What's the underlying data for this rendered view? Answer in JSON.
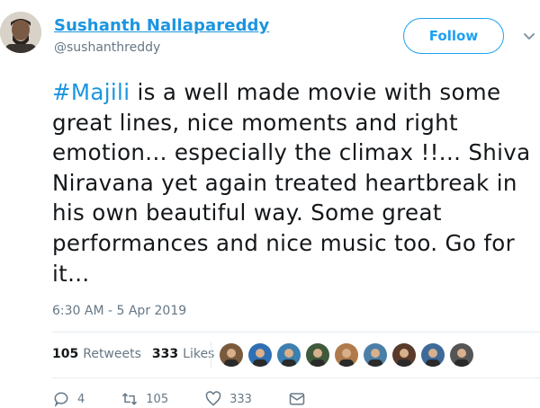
{
  "tweet": {
    "author_name": "Sushanth Nallapareddy",
    "handle": "@sushanthreddy",
    "follow_label": "Follow",
    "hashtag": "#Majili",
    "text_rest": " is a well made movie with some great lines, nice moments and right emotion... especially the climax !!... Shiva Niravana yet again treated heartbreak in his own beautiful way. Some great performances and nice music too. Go for it...",
    "timestamp": "6:30 AM - 5 Apr 2019"
  },
  "stats": {
    "retweets_count": "105",
    "retweets_label": "Retweets",
    "likes_count": "333",
    "likes_label": "Likes"
  },
  "liked_by_avatars": [
    {
      "color": "#7a5a3c"
    },
    {
      "color": "#2f6fb3"
    },
    {
      "color": "#3c7fb0"
    },
    {
      "color": "#3f5a3a"
    },
    {
      "color": "#b07a4a"
    },
    {
      "color": "#4a7fa8"
    },
    {
      "color": "#5a3a2a"
    },
    {
      "color": "#3e6a9a"
    },
    {
      "color": "#555555"
    }
  ],
  "actions": {
    "reply_count": "4",
    "retweet_count": "105",
    "like_count": "333"
  },
  "colors": {
    "link_blue": "#1b95e0",
    "follow_blue": "#1da1f2",
    "muted_gray": "#657786",
    "text": "#14171a"
  }
}
